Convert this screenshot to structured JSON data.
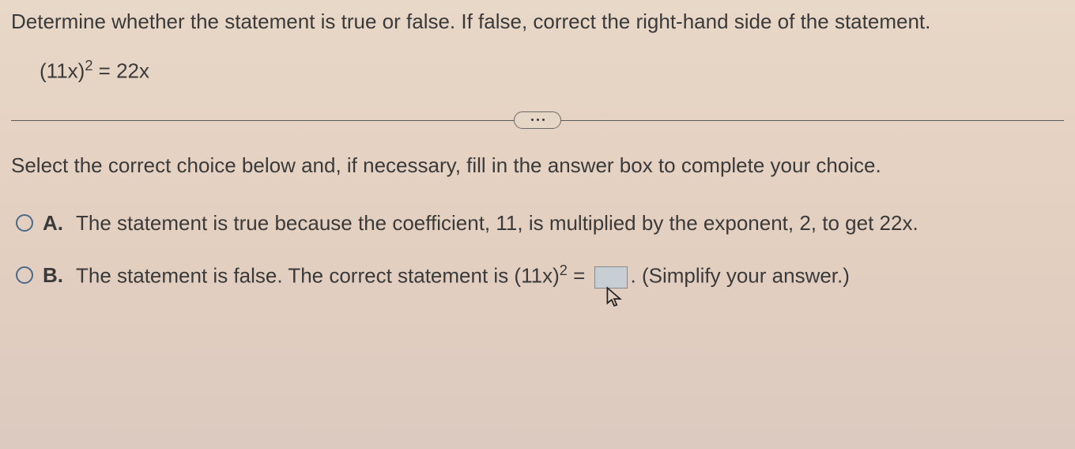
{
  "prompt": "Determine whether the statement is true or false. If false, correct the right-hand side of the statement.",
  "equation": {
    "base": "(11x)",
    "exp": "2",
    "rhs": " = 22x"
  },
  "instruction": "Select the correct choice below and, if necessary, fill in the answer box to complete your choice.",
  "choices": {
    "a": {
      "letter": "A.",
      "text": "The statement is true because the coefficient, 11, is multiplied by the exponent, 2, to get 22x."
    },
    "b": {
      "letter": "B.",
      "pre": "The statement is false. The correct statement is (11x)",
      "exp": "2",
      "mid": " = ",
      "post": ". (Simplify your answer.)"
    }
  }
}
